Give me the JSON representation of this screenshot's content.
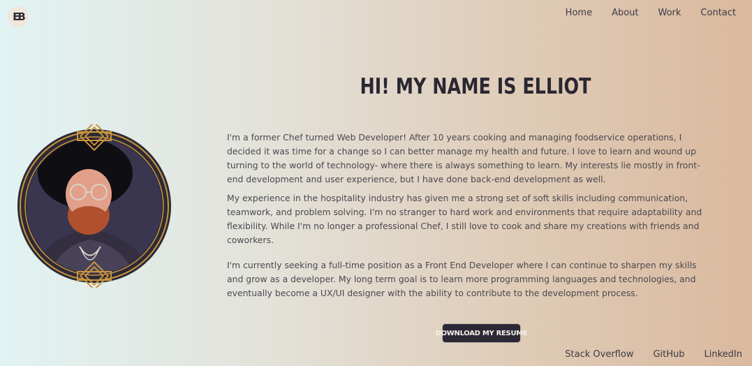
{
  "logo": {
    "text": "EB"
  },
  "nav": {
    "items": [
      "Home",
      "About",
      "Work",
      "Contact"
    ]
  },
  "heading": "HI! MY NAME IS ELLIOT",
  "bio": {
    "p1": "I'm a former Chef turned Web Developer! After 10 years cooking and managing foodservice operations, I decided it was time for a change so I can better manage my health and future. I love to learn and wound up turning to the world of technology- where there is always something to learn. My interests lie mostly in front-end development and user experience, but I have done back-end development as well.",
    "p2": "My experience in the hospitality industry has given me a strong set of soft skills including communication, teamwork, and problem solving. I'm no stranger to hard work and environments that require adaptability and flexibility. While I'm no longer a professional Chef, I still love to cook and share my creations with friends and coworkers.",
    "p3": "I'm currently seeking a full-time position as a Front End Developer where I can continue to sharpen my skills and grow as a developer. My long term goal is to learn more programming languages and technologies, and eventually become a UX/UI designer with the ability to contribute to the development process."
  },
  "resume_button": "DOWNLOAD MY RESUME",
  "social": {
    "items": [
      "Stack Overflow",
      "GitHub",
      "LinkedIn"
    ]
  },
  "colors": {
    "accent_gold": "#c9953f",
    "dark": "#2c2836"
  }
}
